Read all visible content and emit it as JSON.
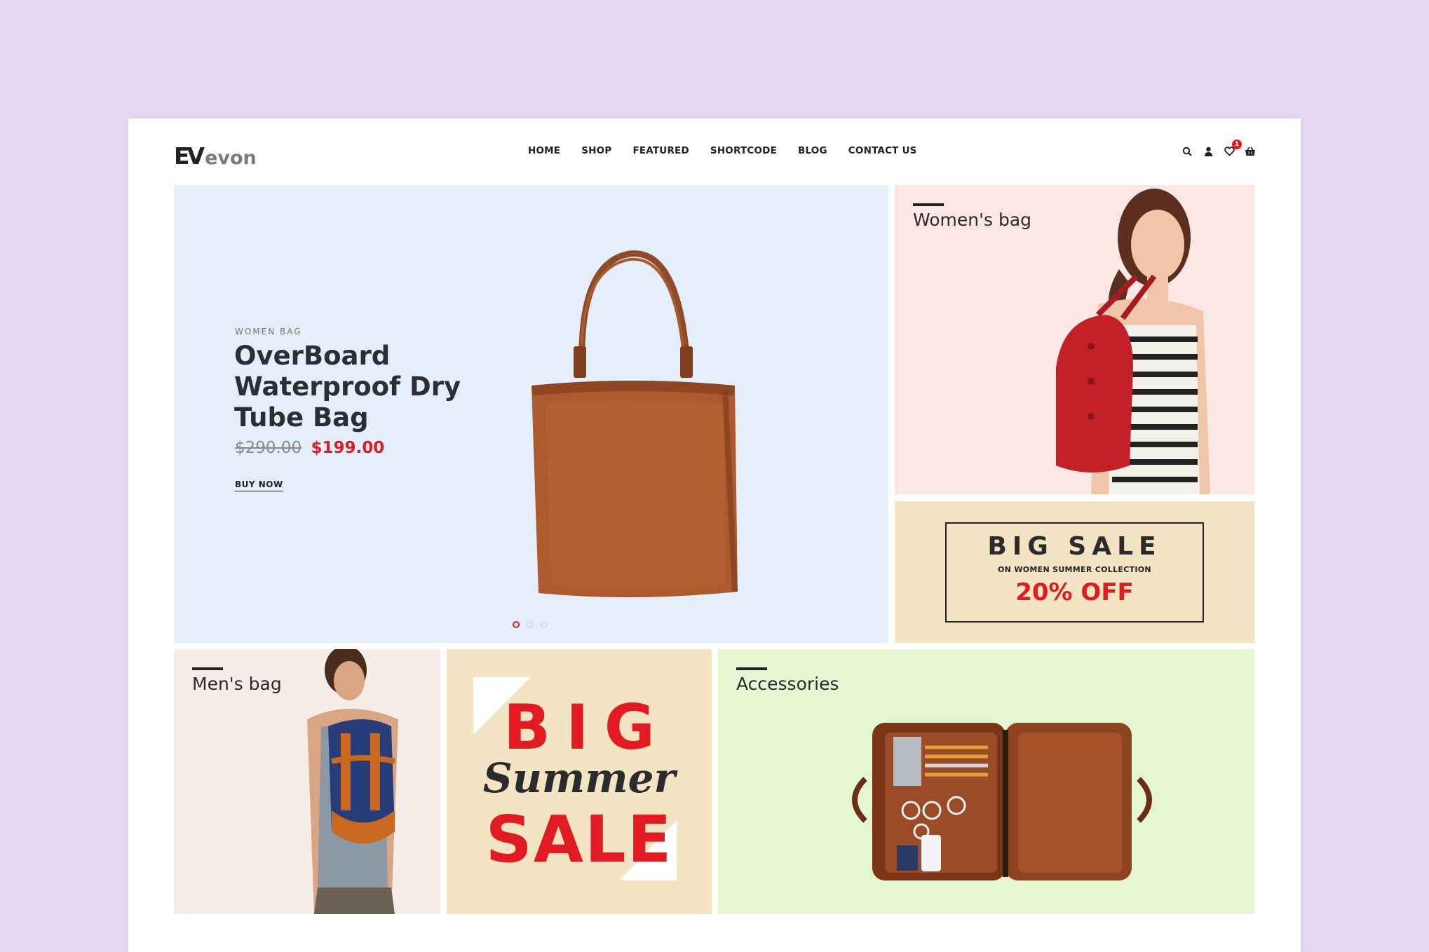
{
  "header": {
    "logo_mark": "EV",
    "logo_text": "evon",
    "nav": [
      "HOME",
      "SHOP",
      "FEATURED",
      "SHORTCODE",
      "BLOG",
      "CONTACT US"
    ],
    "wishlist_count": "1"
  },
  "hero": {
    "category": "WOMEN BAG",
    "title": "OverBoard Waterproof Dry Tube Bag",
    "price_old": "$290.00",
    "price_new": "$199.00",
    "cta": "BUY NOW",
    "slide_count": 3,
    "active_slide": 1
  },
  "tiles": {
    "womens": "Women's bag",
    "mens": "Men's bag",
    "accessories": "Accessories"
  },
  "sale_box": {
    "heading": "BIG SALE",
    "subheading": "ON WOMEN SUMMER COLLECTION",
    "discount": "20% OFF"
  },
  "summer_sale": {
    "line1": "BIG",
    "line2": "Summer",
    "line3": "SALE"
  },
  "colors": {
    "accent": "#e21b23",
    "hero_bg": "#e5eefb",
    "womens_bg": "#fbe7e4",
    "sale_bg": "#f3e5c4",
    "accessories_bg": "#e5f6d3"
  }
}
